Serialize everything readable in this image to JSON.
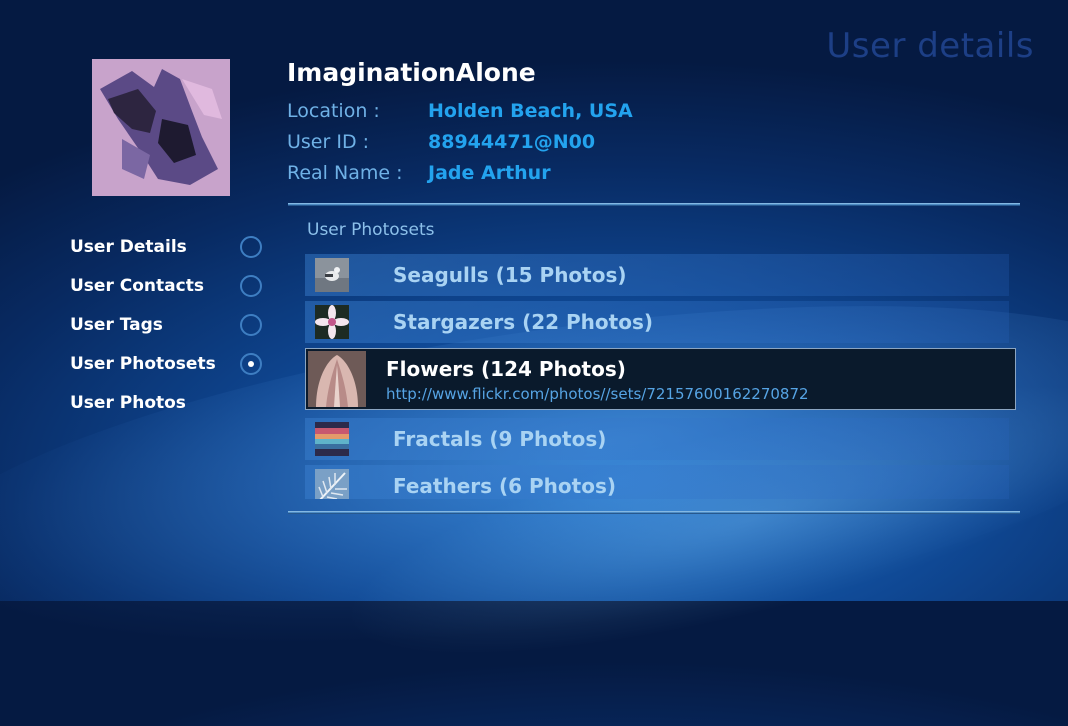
{
  "page_title": "User details",
  "user": {
    "name": "ImaginationAlone",
    "details": [
      {
        "label": "Location :",
        "value": "Holden Beach, USA"
      },
      {
        "label": "User ID :",
        "value": "88944471@N00"
      },
      {
        "label": "Real Name :",
        "value": "Jade Arthur"
      }
    ]
  },
  "nav": {
    "items": [
      {
        "label": "User Details",
        "radio": true,
        "checked": false
      },
      {
        "label": "User Contacts",
        "radio": true,
        "checked": false
      },
      {
        "label": "User Tags",
        "radio": true,
        "checked": false
      },
      {
        "label": "User Photosets",
        "radio": true,
        "checked": true
      },
      {
        "label": "User Photos",
        "radio": false,
        "checked": false
      }
    ]
  },
  "photosets": {
    "section_label": "User Photosets",
    "items": [
      {
        "label": "Seagulls (15 Photos)",
        "thumb": "seagull-thumbnail"
      },
      {
        "label": "Stargazers (22 Photos)",
        "thumb": "lily-thumbnail"
      },
      {
        "label": "Flowers (124 Photos)",
        "url": "http://www.flickr.com/photos//sets/72157600162270872",
        "thumb": "tulip-thumbnail",
        "selected": true
      },
      {
        "label": "Fractals (9 Photos)",
        "thumb": "fractal-thumbnail"
      },
      {
        "label": "Feathers (6 Photos)",
        "thumb": "feather-thumbnail"
      }
    ]
  }
}
